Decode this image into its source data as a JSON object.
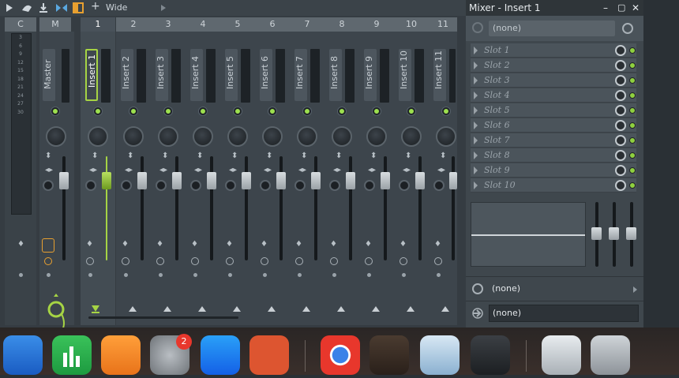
{
  "toolbar": {
    "mode_label": "Wide"
  },
  "mixer": {
    "headers": [
      "C",
      "M",
      "1",
      "2",
      "3",
      "4",
      "5",
      "6",
      "7",
      "8",
      "9",
      "10",
      "11"
    ],
    "master_label": "Master",
    "inserts": [
      "Insert 1",
      "Insert 2",
      "Insert 3",
      "Insert 4",
      "Insert 5",
      "Insert 6",
      "Insert 7",
      "Insert 8",
      "Insert 9",
      "Insert 10",
      "Insert 11"
    ],
    "meter_scale": [
      "3",
      "6",
      "9",
      "12",
      "15",
      "18",
      "21",
      "24",
      "27",
      "30"
    ]
  },
  "panel": {
    "title": "Mixer - Insert 1",
    "preset": "(none)",
    "slots": [
      "Slot 1",
      "Slot 2",
      "Slot 3",
      "Slot 4",
      "Slot 5",
      "Slot 6",
      "Slot 7",
      "Slot 8",
      "Slot 9",
      "Slot 10"
    ],
    "input": "(none)",
    "output": "(none)"
  },
  "dock": {
    "badge": "2"
  },
  "colors": {
    "accent": "#a6d444",
    "led": "#9de04f"
  }
}
